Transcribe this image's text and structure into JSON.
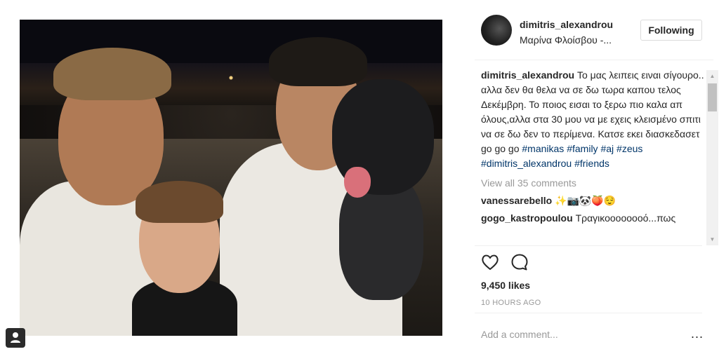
{
  "post": {
    "username": "dimitris_alexandrou",
    "location": "Μαρίνα Φλοίσβου -...",
    "follow_label": "Following",
    "caption_text": "Το μας λειπεις ειναι σίγουρο.. αλλα δεν θα θελα να σε δω τωρα καπου τελος Δεκέμβρη. Το ποιος εισαι το ξερω πιο καλα απ όλους,αλλα στα 30 μου να με εχεις κλεισμένο σπιτι να σε δω δεν το περίμενα. Κατσε εκει διασκεδασετ go go go",
    "hashtags": [
      "#manikas",
      "#family",
      "#aj",
      "#zeus",
      "#dimitris_alexandrou",
      "#friends"
    ],
    "view_all_comments": "View all 35 comments",
    "comments": [
      {
        "user": "vanessarebello",
        "text": "✨📷🐼🍑😌"
      },
      {
        "user": "gogo_kastropoulou",
        "text": "Τραγικοοοοοοοό...πως"
      }
    ],
    "likes": "9,450 likes",
    "time_ago": "10 HOURS AGO",
    "comment_placeholder": "Add a comment...",
    "more_icon": "..."
  },
  "icons": {
    "like": "heart-outline-icon",
    "comment": "speech-bubble-icon",
    "user_badge": "user-silhouette-icon"
  },
  "colors": {
    "hashtag": "#003569",
    "muted": "#999999",
    "text": "#262626"
  }
}
